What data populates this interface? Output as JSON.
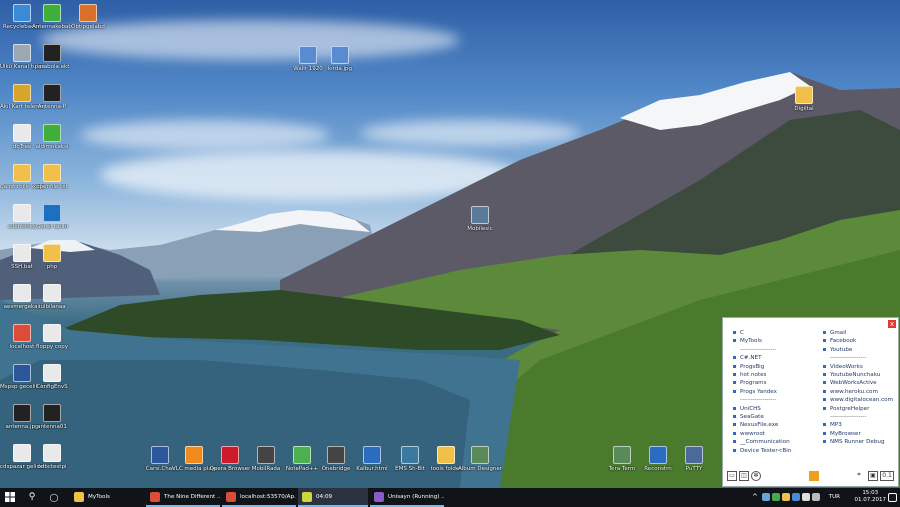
{
  "desktop": {
    "icons": [
      {
        "label": "Recyclebacon",
        "color": "#3a8ad6"
      },
      {
        "label": "Antennakebab",
        "color": "#3fae3a"
      },
      {
        "label": "Obtipgelabd",
        "color": "#d8702a"
      },
      {
        "label": "Ülkü Kanal tulçu",
        "color": "#9aa8b6"
      },
      {
        "label": "parabola.ekt",
        "color": "#222"
      },
      {
        "label": "Akıl Kart telemetri ekar",
        "color": "#d7a42c"
      },
      {
        "label": "Antenna-P",
        "color": "#222"
      },
      {
        "label": "dbTree",
        "color": "#e9e9e9"
      },
      {
        "label": "aldımnkaksi",
        "color": "#3fae3a"
      },
      {
        "label": "Çalıştırbilir kodlar",
        "color": "#f0c04a"
      },
      {
        "label": "openfile txt",
        "color": "#f0c04a"
      },
      {
        "label": "clientlinks",
        "color": "#e9e9e9"
      },
      {
        "label": "Genel tarihi",
        "color": "#1f6fc0"
      },
      {
        "label": "SSH.bat",
        "color": "#e9e9e9"
      },
      {
        "label": "php",
        "color": "#f0c04a"
      },
      {
        "label": "aesmergekas",
        "color": "#e9e9e9"
      },
      {
        "label": "tulbilanaa",
        "color": "#e9e9e9"
      },
      {
        "label": "localhost",
        "color": "#dd4b39"
      },
      {
        "label": "floppy copy",
        "color": "#e9e9e9"
      },
      {
        "label": "Mspsp gecelik lo",
        "color": "#2b579a"
      },
      {
        "label": "ConfigEnvS",
        "color": "#e9e9e9"
      },
      {
        "label": "antenna.jpg",
        "color": "#222"
      },
      {
        "label": "antenna01",
        "color": "#222"
      },
      {
        "label": "cdspazar gelirleri",
        "color": "#e9e9e9"
      },
      {
        "label": "odbctestpi",
        "color": "#e9e9e9"
      },
      {
        "label": "Wallr 1920",
        "color": "#5a8ad0"
      },
      {
        "label": "kırda.jpg",
        "color": "#5a8ad0"
      },
      {
        "label": "Digiital",
        "color": "#f0c04a"
      },
      {
        "label": "Mobilesic",
        "color": "#5a7a9a"
      },
      {
        "label": "Carsi.Chat",
        "color": "#2b579a"
      },
      {
        "label": "VLC media player",
        "color": "#f08a1c"
      },
      {
        "label": "Opera Browser",
        "color": "#cc1b2b"
      },
      {
        "label": "MobilRada",
        "color": "#444"
      },
      {
        "label": "NotePad++",
        "color": "#4caf50"
      },
      {
        "label": "Onebridge",
        "color": "#444"
      },
      {
        "label": "Kalbur.html",
        "color": "#2b6cc0"
      },
      {
        "label": "EMS Sh-Bit",
        "color": "#3a7aa0"
      },
      {
        "label": "tools folder",
        "color": "#f0c04a"
      },
      {
        "label": "Album Designer",
        "color": "#5a8a5a"
      },
      {
        "label": "Tera Term",
        "color": "#5a8a5a"
      },
      {
        "label": "Reconstrn",
        "color": "#2b6cc0"
      },
      {
        "label": "PuTTY",
        "color": "#4a6a9a"
      }
    ]
  },
  "launcher": {
    "close_label": "x",
    "left": [
      "C",
      "MyTools",
      "------------------",
      "C#.NET",
      "ProgsBig",
      "hot notes",
      "Programs",
      "Progs Yandex",
      "------------------",
      "UniCHS",
      "SeaGate",
      "NexusFile.exe",
      "wwwroot",
      "__Communication",
      "Device Tester<Bin"
    ],
    "right": [
      "Gmail",
      "Facebook",
      "Youtube",
      "------------------",
      "VideoWorks",
      "YoutubeNunchaku",
      "WebWorksActive",
      "www.heroku.com",
      "www.digitalocean.com",
      "PostgreHelper",
      "------------------",
      "MP3",
      "MyBrowser",
      "NMS Runner Debug"
    ],
    "bottom_left_icons": [
      "folder-icon",
      "disk-icon",
      "settings-icon"
    ],
    "bottom_right_icons": [
      "crop-icon",
      "window-icon",
      "counter-icon"
    ],
    "counter": "0.1"
  },
  "taskbar": {
    "buttons": [
      {
        "label": "MyTools",
        "color": "#f0c04a",
        "state": "normal"
      },
      {
        "label": "The Nine Different ...",
        "color": "#dd4b39",
        "state": "running"
      },
      {
        "label": "localhost:53570/Ap...",
        "color": "#dd4b39",
        "state": "running"
      },
      {
        "label": "04:09",
        "color": "#c9d83a",
        "state": "active"
      },
      {
        "label": "Unisayn (Running) ...",
        "color": "#8a5ac8",
        "state": "running"
      }
    ],
    "language": "TUR",
    "time": "15:03",
    "date": "01.07.2017"
  }
}
